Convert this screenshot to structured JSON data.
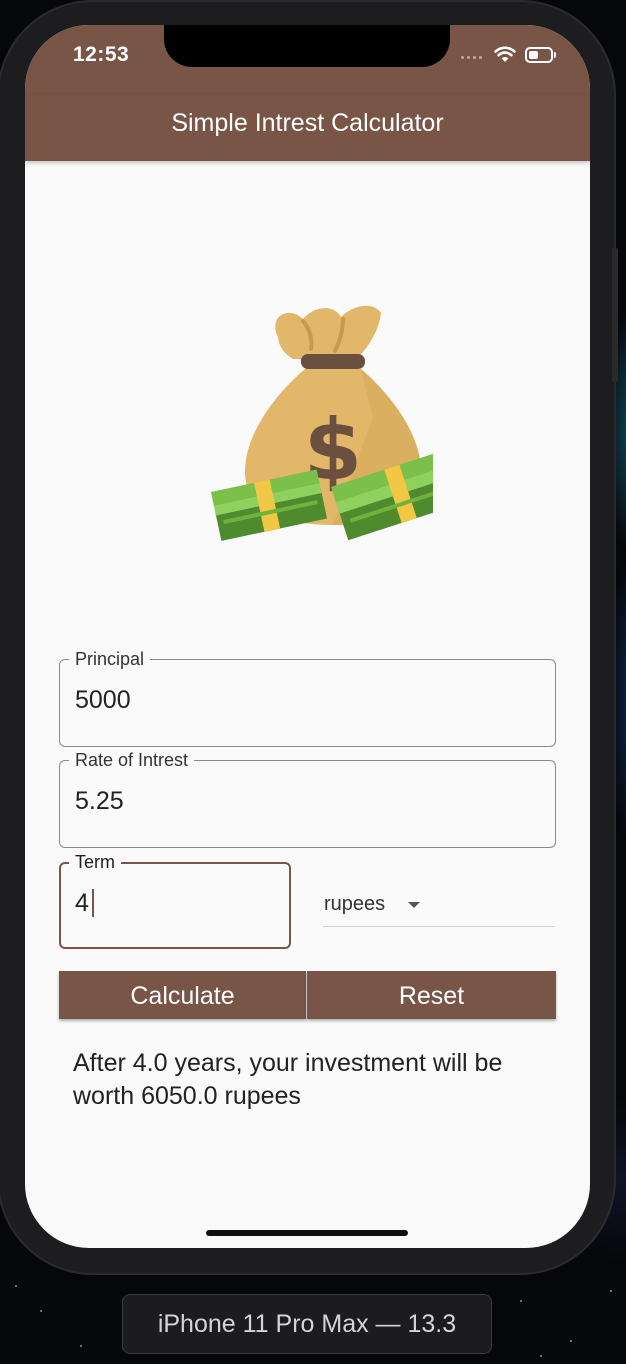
{
  "status_bar": {
    "time": "12:53"
  },
  "app_bar": {
    "title": "Simple Intrest Calculator"
  },
  "illustration": {
    "icon": "money-bag-icon",
    "symbol": "$"
  },
  "form": {
    "principal": {
      "label": "Principal",
      "value": "5000"
    },
    "rate": {
      "label": "Rate of Intrest",
      "value": "5.25"
    },
    "term": {
      "label": "Term",
      "value": "4"
    },
    "currency": {
      "selected": "rupees"
    }
  },
  "buttons": {
    "calculate": "Calculate",
    "reset": "Reset"
  },
  "result": {
    "text": "After 4.0 years, your investment will be worth 6050.0 rupees"
  },
  "simulator": {
    "device_name": "iPhone 11 Pro Max — 13.3"
  },
  "colors": {
    "primary": "#795548",
    "background": "#fafafa",
    "bag": "#e2b76a",
    "cash": "#6fb33e"
  }
}
